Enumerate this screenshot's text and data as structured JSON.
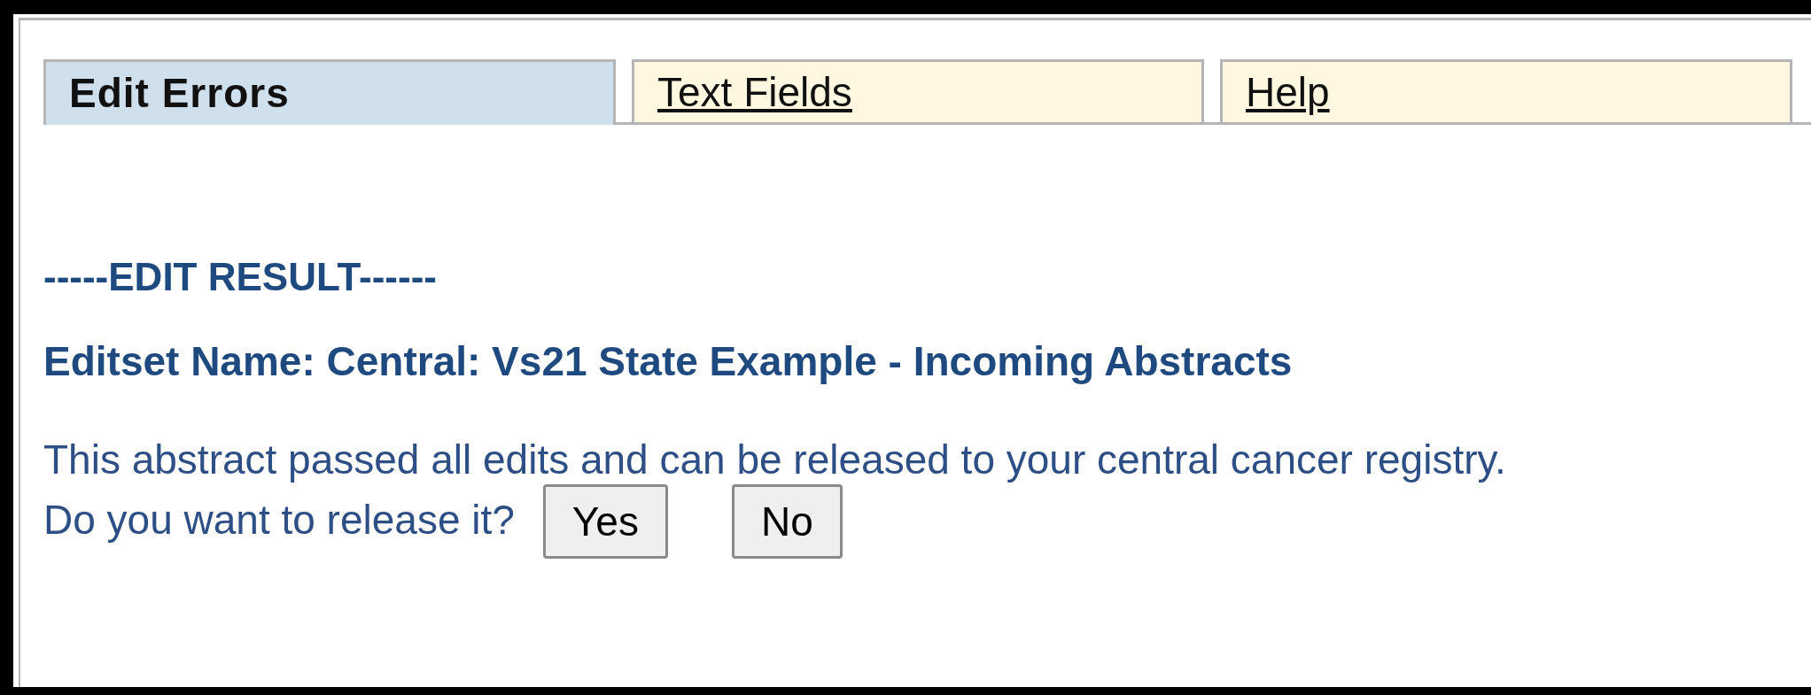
{
  "tabs": [
    {
      "label": "Edit Errors",
      "selected": true
    },
    {
      "label": "Text Fields",
      "selected": false
    },
    {
      "label": "Help",
      "selected": false
    }
  ],
  "heading": "-----EDIT RESULT------",
  "editset": "Editset Name: Central: Vs21 State Example - Incoming Abstracts",
  "message": [
    "This abstract passed all edits and can be released to your central cancer registry.",
    "Do you want to release it?"
  ],
  "buttons": [
    "Yes",
    "No"
  ]
}
